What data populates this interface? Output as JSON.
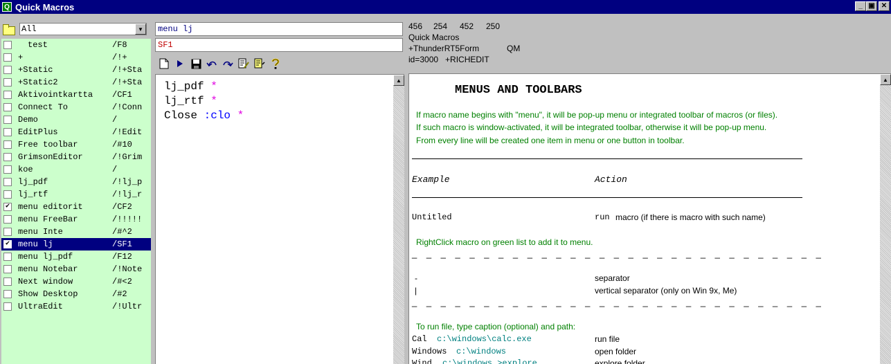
{
  "window": {
    "title": "Quick Macros",
    "app_icon": "Q"
  },
  "filter": {
    "value": "All"
  },
  "macros": [
    {
      "name": "test",
      "hotkey": "/F8",
      "checked": false,
      "selected": false,
      "indent": true
    },
    {
      "name": "+",
      "hotkey": "/!+",
      "checked": false,
      "selected": false
    },
    {
      "name": "+Static",
      "hotkey": "/!+Sta",
      "checked": false,
      "selected": false
    },
    {
      "name": "+Static2",
      "hotkey": "/!+Sta",
      "checked": false,
      "selected": false
    },
    {
      "name": "Aktivointkartta",
      "hotkey": "/CF1",
      "checked": false,
      "selected": false
    },
    {
      "name": "Connect To",
      "hotkey": "/!Conn",
      "checked": false,
      "selected": false
    },
    {
      "name": "Demo",
      "hotkey": "/",
      "checked": false,
      "selected": false
    },
    {
      "name": "EditPlus",
      "hotkey": "/!Edit",
      "checked": false,
      "selected": false
    },
    {
      "name": "Free toolbar",
      "hotkey": "/#10",
      "checked": false,
      "selected": false
    },
    {
      "name": "GrimsonEditor",
      "hotkey": "/!Grim",
      "checked": false,
      "selected": false
    },
    {
      "name": "koe",
      "hotkey": "/",
      "checked": false,
      "selected": false
    },
    {
      "name": "lj_pdf",
      "hotkey": "/!lj_p",
      "checked": false,
      "selected": false
    },
    {
      "name": "lj_rtf",
      "hotkey": "/!lj_r",
      "checked": false,
      "selected": false
    },
    {
      "name": "menu editorit",
      "hotkey": "/CF2",
      "checked": true,
      "selected": false
    },
    {
      "name": "menu FreeBar",
      "hotkey": "/!!!!!",
      "checked": false,
      "selected": false
    },
    {
      "name": "menu Inte",
      "hotkey": "/#^2",
      "checked": false,
      "selected": false
    },
    {
      "name": "menu lj",
      "hotkey": "/SF1",
      "checked": true,
      "selected": true
    },
    {
      "name": "menu lj_pdf",
      "hotkey": "/F12",
      "checked": false,
      "selected": false
    },
    {
      "name": "menu Notebar",
      "hotkey": "/!Note",
      "checked": false,
      "selected": false
    },
    {
      "name": "Next window",
      "hotkey": "/#<2",
      "checked": false,
      "selected": false
    },
    {
      "name": "Show Desktop",
      "hotkey": "/#2",
      "checked": false,
      "selected": false
    },
    {
      "name": "UltraEdit",
      "hotkey": "/!Ultr",
      "checked": false,
      "selected": false
    }
  ],
  "editor": {
    "macro_name": "menu lj",
    "trigger": "SF1",
    "lines": [
      {
        "text": "lj_pdf ",
        "label": "",
        "star": "*"
      },
      {
        "text": "lj_rtf ",
        "label": "",
        "star": "*"
      },
      {
        "text": "Close ",
        "label": ":clo",
        "star": " *"
      }
    ]
  },
  "info": {
    "line1": [
      "456",
      "254",
      "452",
      "250"
    ],
    "line2": "Quick Macros",
    "line3a": "+ThunderRT5Form",
    "line3b": "QM",
    "line4": "id=3000   +RICHEDIT"
  },
  "help": {
    "heading": "MENUS AND TOOLBARS",
    "intro": [
      "If macro name begins with \"menu\", it will be pop-up menu or integrated toolbar of macros (or files).",
      "If such macro is window-activated, it will be integrated toolbar, otherwise it will be pop-up menu.",
      "From every line will be created one item in menu or one button in toolbar."
    ],
    "col_example": "Example",
    "col_action": "Action",
    "ex_untitled": "Untitled",
    "ex_untitled_run": "run",
    "ex_untitled_action": "macro (if there is macro with such name)",
    "rightclick_note": "RightClick macro on green list to add it to menu.",
    "dashes": "_ _ _ _ _ _ _ _ _ _ _ _ _ _ _ _ _ _ _ _ _ _ _ _ _ _ _ _ _",
    "sep_example": "-",
    "sep_action": "separator",
    "vsep_example": "|",
    "vsep_action": "vertical separator (only on Win 9x, Me)",
    "run_file_note": "To run file, type caption (optional) and path:",
    "file_rows": [
      {
        "caption": "Cal",
        "path": "c:\\windows\\calc.exe",
        "action": "run file"
      },
      {
        "caption": "Windows",
        "path": "c:\\windows",
        "action": "open folder"
      },
      {
        "caption": "Wind",
        "path": "c:\\windows >explore",
        "action": "explore folder"
      }
    ]
  }
}
